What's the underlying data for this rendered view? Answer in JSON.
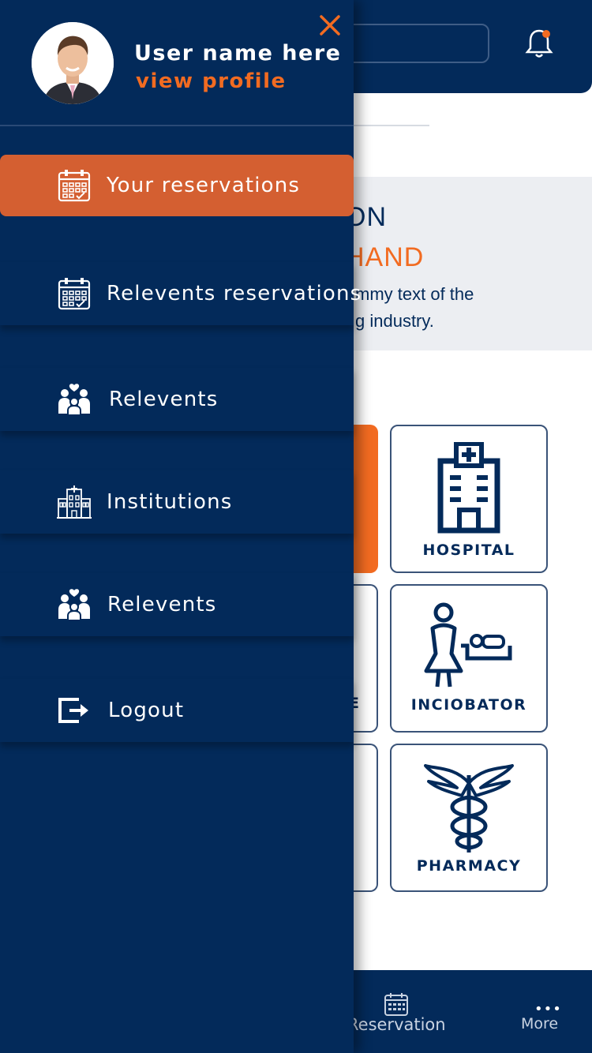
{
  "header": {
    "search_placeholder": "",
    "notification_icon": "bell-icon"
  },
  "banner": {
    "title_fragment": "ON",
    "subtitle_fragment": "HAND",
    "desc_line1": "mmy text of the",
    "desc_line2": "g industry."
  },
  "tiles": [
    {
      "label": "HOSPITAL",
      "icon": "hospital-icon"
    },
    {
      "label": "INCIOBATOR",
      "icon": "incubator-icon"
    },
    {
      "label": "PHARMACY",
      "icon": "pharmacy-icon"
    },
    {
      "label": "E",
      "icon": ""
    }
  ],
  "bottom_nav": {
    "reservation_label": "Reservation",
    "more_label": "More",
    "more_dots": "•••"
  },
  "drawer": {
    "user_name": "User name here",
    "view_profile": "view profile",
    "close_icon": "close-icon",
    "items": [
      {
        "label": "Your reservations",
        "icon": "calendar-icon",
        "active": true
      },
      {
        "label": "Relevents reservations",
        "icon": "calendar-icon",
        "active": false
      },
      {
        "label": "Relevents",
        "icon": "family-icon",
        "active": false
      },
      {
        "label": "Institutions",
        "icon": "institution-icon",
        "active": false
      },
      {
        "label": "Relevents",
        "icon": "family-icon",
        "active": false
      },
      {
        "label": "Logout",
        "icon": "logout-icon",
        "active": false
      }
    ]
  },
  "colors": {
    "navy": "#032a5a",
    "accent": "#f26b21",
    "active_item": "#d45f31"
  }
}
